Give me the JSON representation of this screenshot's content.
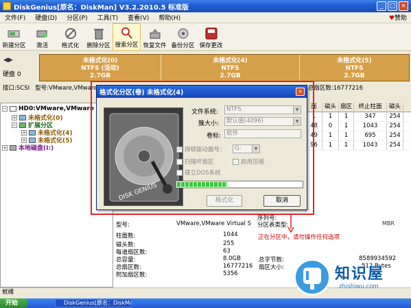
{
  "window": {
    "title": "DiskGenius[原名：DiskMan] V3.2.2010.5 标准版"
  },
  "menu": {
    "items": [
      "文件(F)",
      "硬盘(D)",
      "分区(P)",
      "工具(T)",
      "查看(V)",
      "帮助(H)"
    ],
    "help_link": "赞助"
  },
  "toolbar": {
    "buttons": [
      "新建分区",
      "激活",
      "格式化",
      "删除分区",
      "搜索分区",
      "恢复文件",
      "备份分区",
      "保存更改"
    ]
  },
  "disk_map": {
    "disk_label": "硬盘 0",
    "partitions": [
      {
        "name": "未格式化(0)",
        "fs": "NTFS (活动)",
        "size": "2.7GB"
      },
      {
        "name": "未格式化(4)",
        "fs": "NTFS",
        "size": "2.7GB"
      },
      {
        "name": "未格式化(5)",
        "fs": "NTFS",
        "size": "2.7GB"
      }
    ]
  },
  "disk_info_line": {
    "interface": "接口:SCSI",
    "model": "型号:VMware,VMware",
    "sectors": "总扇区数:16777216"
  },
  "tree": {
    "items": [
      {
        "label": "HD0:VMware,VMware Virt",
        "level": 0
      },
      {
        "label": "未格式化(0)",
        "level": 1
      },
      {
        "label": "扩展分区",
        "level": 1
      },
      {
        "label": "未格式化(4)",
        "level": 2
      },
      {
        "label": "未格式化(5)",
        "level": 2
      },
      {
        "label": "本地磁盘(I:)",
        "level": 0
      }
    ]
  },
  "partition_table": {
    "headers": [
      "面",
      "磁头",
      "扇区",
      "终止柱面",
      "磁头"
    ],
    "rows": [
      [
        "1",
        "1",
        "1",
        "347",
        "254"
      ],
      [
        "48",
        "0",
        "1",
        "1043",
        "254"
      ],
      [
        "49",
        "1",
        "1",
        "695",
        "254"
      ],
      [
        "96",
        "1",
        "1",
        "1043",
        "254"
      ]
    ]
  },
  "details": {
    "model_label": "型号:",
    "model_value": "VMware,VMware Virtual S",
    "rows": [
      {
        "label": "柱面数:",
        "value": "1044"
      },
      {
        "label": "磁头数:",
        "value": "255"
      },
      {
        "label": "每道扇区数:",
        "value": "63"
      },
      {
        "label": "总容量:",
        "value": "8.0GB"
      },
      {
        "label": "总扇区数:",
        "value": "16777216"
      },
      {
        "label": "附加扇区数:",
        "value": "5356"
      }
    ],
    "right_labels": [
      "序列号:",
      "分区表类型:"
    ],
    "right_code": "MBR",
    "bytes_label": "总字节数:",
    "bytes_value": "8589934592",
    "sector_size_label": "扇区大小:",
    "sector_size_value": "512 Bytes",
    "warning": "正在分区中，请勿操作任何选项"
  },
  "dialog": {
    "title": "格式化分区(卷) 未格式化(4)",
    "fs_label": "文件系统:",
    "fs_value": "NTFS",
    "cluster_label": "簇大小:",
    "cluster_value": "默认值(4096)",
    "volume_label": "卷标:",
    "volume_value": "软件",
    "check_driver": "排顿驱动器号：",
    "driver_value": "G:",
    "check_scan": "扫描坏扇区",
    "check_compress": "启用压缩",
    "check_dos": "建立DOS系统",
    "progress": 0.4,
    "btn_format": "格式化",
    "btn_cancel": "取消"
  },
  "status": {
    "text": "就绪"
  },
  "taskbar": {
    "start": "开始",
    "app": "DiskGenius[原名：DiskMa"
  },
  "watermark": {
    "name": "知识屋",
    "url": "zhishiwu.com"
  },
  "colors": {
    "partition_bar": "#d6a04a",
    "title_blue": "#1f5fd6",
    "warning_red": "#d00000",
    "progress_green": "#3cc63c"
  }
}
